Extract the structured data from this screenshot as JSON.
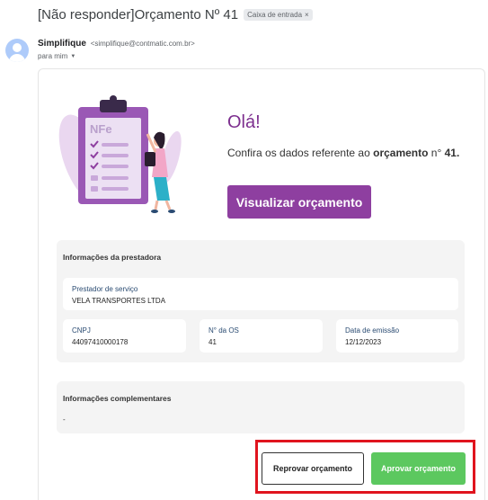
{
  "subject": "[Não responder]Orçamento Nº 41",
  "label_chip": "Caixa de entrada",
  "sender": {
    "name": "Simplifique",
    "email": "<simplifique@contmatic.com.br>",
    "to": "para mim"
  },
  "illustration": {
    "badge": "NFe"
  },
  "greeting": "Olá!",
  "message": {
    "prefix": "Confira os dados referente ao ",
    "bold1": "orçamento",
    "mid": " n° ",
    "bold2": "41."
  },
  "view_button": "Visualizar orçamento",
  "provider_section": {
    "title": "Informações da prestadora",
    "provider": {
      "label": "Prestador de serviço",
      "value": "VELA TRANSPORTES LTDA"
    },
    "cnpj": {
      "label": "CNPJ",
      "value": "44097410000178"
    },
    "os": {
      "label": "N° da OS",
      "value": "41"
    },
    "date": {
      "label": "Data de emissão",
      "value": "12/12/2023"
    }
  },
  "complement_section": {
    "title": "Informações complementares",
    "value": "-"
  },
  "actions": {
    "reject": "Reprovar orçamento",
    "approve": "Aprovar orçamento"
  },
  "colors": {
    "accent": "#8e3fa0",
    "approve": "#5cc85f",
    "highlight": "#e0141e"
  }
}
